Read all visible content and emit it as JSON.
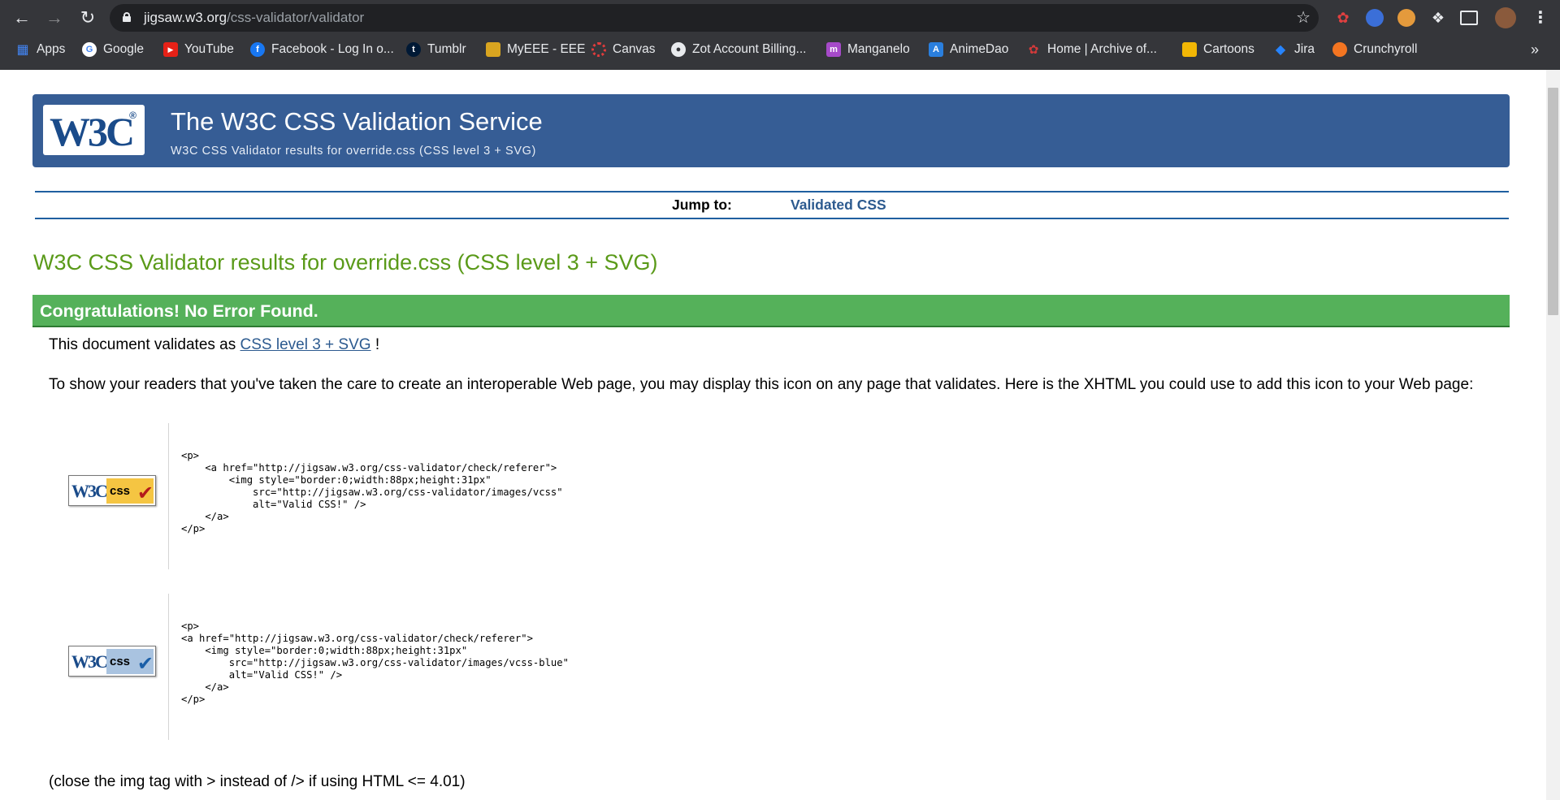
{
  "browser": {
    "url_host": "jigsaw.w3.org",
    "url_path": "/css-validator/validator",
    "bookmarks": [
      {
        "label": "Apps",
        "icon": "apps-grid-icon"
      },
      {
        "label": "Google",
        "icon": "google-icon"
      },
      {
        "label": "YouTube",
        "icon": "youtube-icon"
      },
      {
        "label": "Facebook - Log In o...",
        "icon": "facebook-icon"
      },
      {
        "label": "Tumblr",
        "icon": "tumblr-icon"
      },
      {
        "label": "MyEEE - EEE",
        "icon": "myeee-icon"
      },
      {
        "label": "Canvas",
        "icon": "canvas-icon"
      },
      {
        "label": "Zot Account Billing...",
        "icon": "zot-icon"
      },
      {
        "label": "Manganelo",
        "icon": "manganelo-icon"
      },
      {
        "label": "AnimeDao",
        "icon": "animedao-icon"
      },
      {
        "label": "Home | Archive of...",
        "icon": "ao3-icon"
      },
      {
        "label": "Cartoons",
        "icon": "cartoons-icon"
      },
      {
        "label": "Jira",
        "icon": "jira-icon"
      },
      {
        "label": "Crunchyroll",
        "icon": "crunchyroll-icon"
      }
    ],
    "more_bookmarks": "»"
  },
  "banner": {
    "logo_text": "W3C",
    "logo_reg": "®",
    "title": "The W3C CSS Validation Service",
    "subtitle": "W3C CSS Validator results for override.css (CSS level 3 + SVG)"
  },
  "jump": {
    "label": "Jump to:",
    "link": "Validated CSS"
  },
  "results": {
    "heading": "W3C CSS Validator results for override.css (CSS level 3 + SVG)",
    "success": "Congratulations! No Error Found.",
    "validates_prefix": "This document validates as",
    "validates_link": "CSS level 3 + SVG",
    "validates_suffix": "!",
    "paragraph": "To show your readers that you've taken the care to create an interoperable Web page, you may display this icon on any page that validates. Here is the XHTML you could use to add this icon to your Web page:",
    "badges": [
      {
        "style": "gold",
        "w3c": "W3C",
        "css": "css",
        "code": "<p>\n    <a href=\"http://jigsaw.w3.org/css-validator/check/referer\">\n        <img style=\"border:0;width:88px;height:31px\"\n            src=\"http://jigsaw.w3.org/css-validator/images/vcss\"\n            alt=\"Valid CSS!\" />\n    </a>\n</p>"
      },
      {
        "style": "blue",
        "w3c": "W3C",
        "css": "css",
        "code": "<p>\n<a href=\"http://jigsaw.w3.org/css-validator/check/referer\">\n    <img style=\"border:0;width:88px;height:31px\"\n        src=\"http://jigsaw.w3.org/css-validator/images/vcss-blue\"\n        alt=\"Valid CSS!\" />\n    </a>\n</p>"
      }
    ],
    "note": "(close the img tag with > instead of /> if using HTML <= 4.01)"
  }
}
